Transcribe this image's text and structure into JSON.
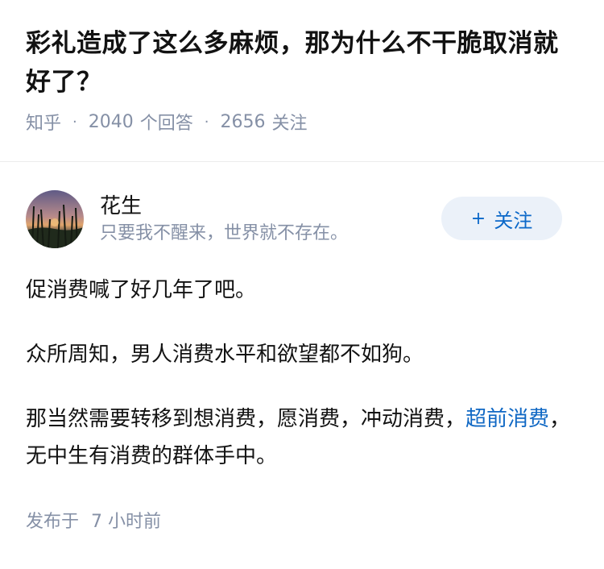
{
  "question": {
    "title": "彩礼造成了这么多麻烦，那为什么不干脆取消就好了？",
    "source": "知乎",
    "answer_count": "2040",
    "answer_label": "个回答",
    "follower_count": "2656",
    "follower_label": "关注"
  },
  "answer": {
    "author_name": "花生",
    "author_bio": "只要我不醒来，世界就不存在。",
    "follow_label": "关注",
    "paragraphs": [
      "促消费喊了好几年了吧。",
      "众所周知，男人消费水平和欲望都不如狗。"
    ],
    "p3_before": "那当然需要转移到想消费，愿消费，冲动消费，",
    "p3_link": "超前消费",
    "p3_after": "，无中生有消费的群体手中。",
    "time_label": "发布于",
    "time_value": "7 小时前"
  },
  "colors": {
    "accent": "#0b68c9",
    "muted": "#8590a6",
    "follow_bg": "#ebf1f9"
  }
}
